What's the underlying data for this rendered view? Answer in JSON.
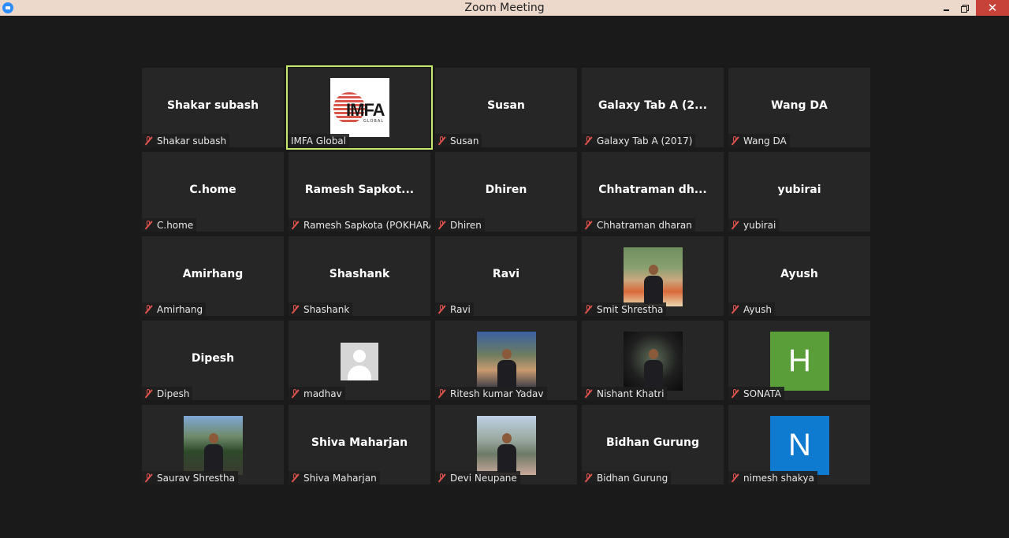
{
  "window": {
    "title": "Zoom Meeting",
    "close_label": "✕"
  },
  "colors": {
    "active_speaker": "#c6e86c",
    "muted_icon": "#e0534d",
    "avatar_h": "#5a9e3a",
    "avatar_n": "#0e7bd1"
  },
  "participants": [
    {
      "display": "Shakar subash",
      "label": "Shakar subash",
      "tile": "name"
    },
    {
      "display": "",
      "label": "IMFA Global",
      "tile": "logo",
      "logo_text": "IMFA",
      "logo_sub": "GLOBAL"
    },
    {
      "display": "Susan",
      "label": "Susan",
      "tile": "name"
    },
    {
      "display": "Galaxy Tab A  (2...",
      "label": "Galaxy Tab A (2017)",
      "tile": "name"
    },
    {
      "display": "Wang DA",
      "label": "Wang DA",
      "tile": "name"
    },
    {
      "display": "C.home",
      "label": "C.home",
      "tile": "name"
    },
    {
      "display": "Ramesh  Sapkot...",
      "label": "Ramesh Sapkota (POKHARA)",
      "tile": "name"
    },
    {
      "display": "Dhiren",
      "label": "Dhiren",
      "tile": "name"
    },
    {
      "display": "Chhatraman  dh...",
      "label": "Chhatraman dharan",
      "tile": "name"
    },
    {
      "display": "yubirai",
      "label": "yubirai",
      "tile": "name"
    },
    {
      "display": "Amirhang",
      "label": "Amirhang",
      "tile": "name"
    },
    {
      "display": "Shashank",
      "label": "Shashank",
      "tile": "name"
    },
    {
      "display": "Ravi",
      "label": "Ravi",
      "tile": "name"
    },
    {
      "display": "",
      "label": "Smit Shrestha",
      "tile": "photo"
    },
    {
      "display": "Ayush",
      "label": "Ayush",
      "tile": "name"
    },
    {
      "display": "Dipesh",
      "label": "Dipesh",
      "tile": "name"
    },
    {
      "display": "",
      "label": "madhav",
      "tile": "generic"
    },
    {
      "display": "",
      "label": "Ritesh kumar Yadav",
      "tile": "photo"
    },
    {
      "display": "",
      "label": "Nishant Khatri",
      "tile": "photo"
    },
    {
      "display": "",
      "label": "SONATA",
      "tile": "letter",
      "letter": "H"
    },
    {
      "display": "",
      "label": "Saurav Shrestha",
      "tile": "photo"
    },
    {
      "display": "Shiva Maharjan",
      "label": "Shiva Maharjan",
      "tile": "name"
    },
    {
      "display": "",
      "label": "Devi Neupane",
      "tile": "photo"
    },
    {
      "display": "Bidhan Gurung",
      "label": "Bidhan Gurung",
      "tile": "name"
    },
    {
      "display": "",
      "label": "nimesh shakya",
      "tile": "letter",
      "letter": "N"
    }
  ]
}
